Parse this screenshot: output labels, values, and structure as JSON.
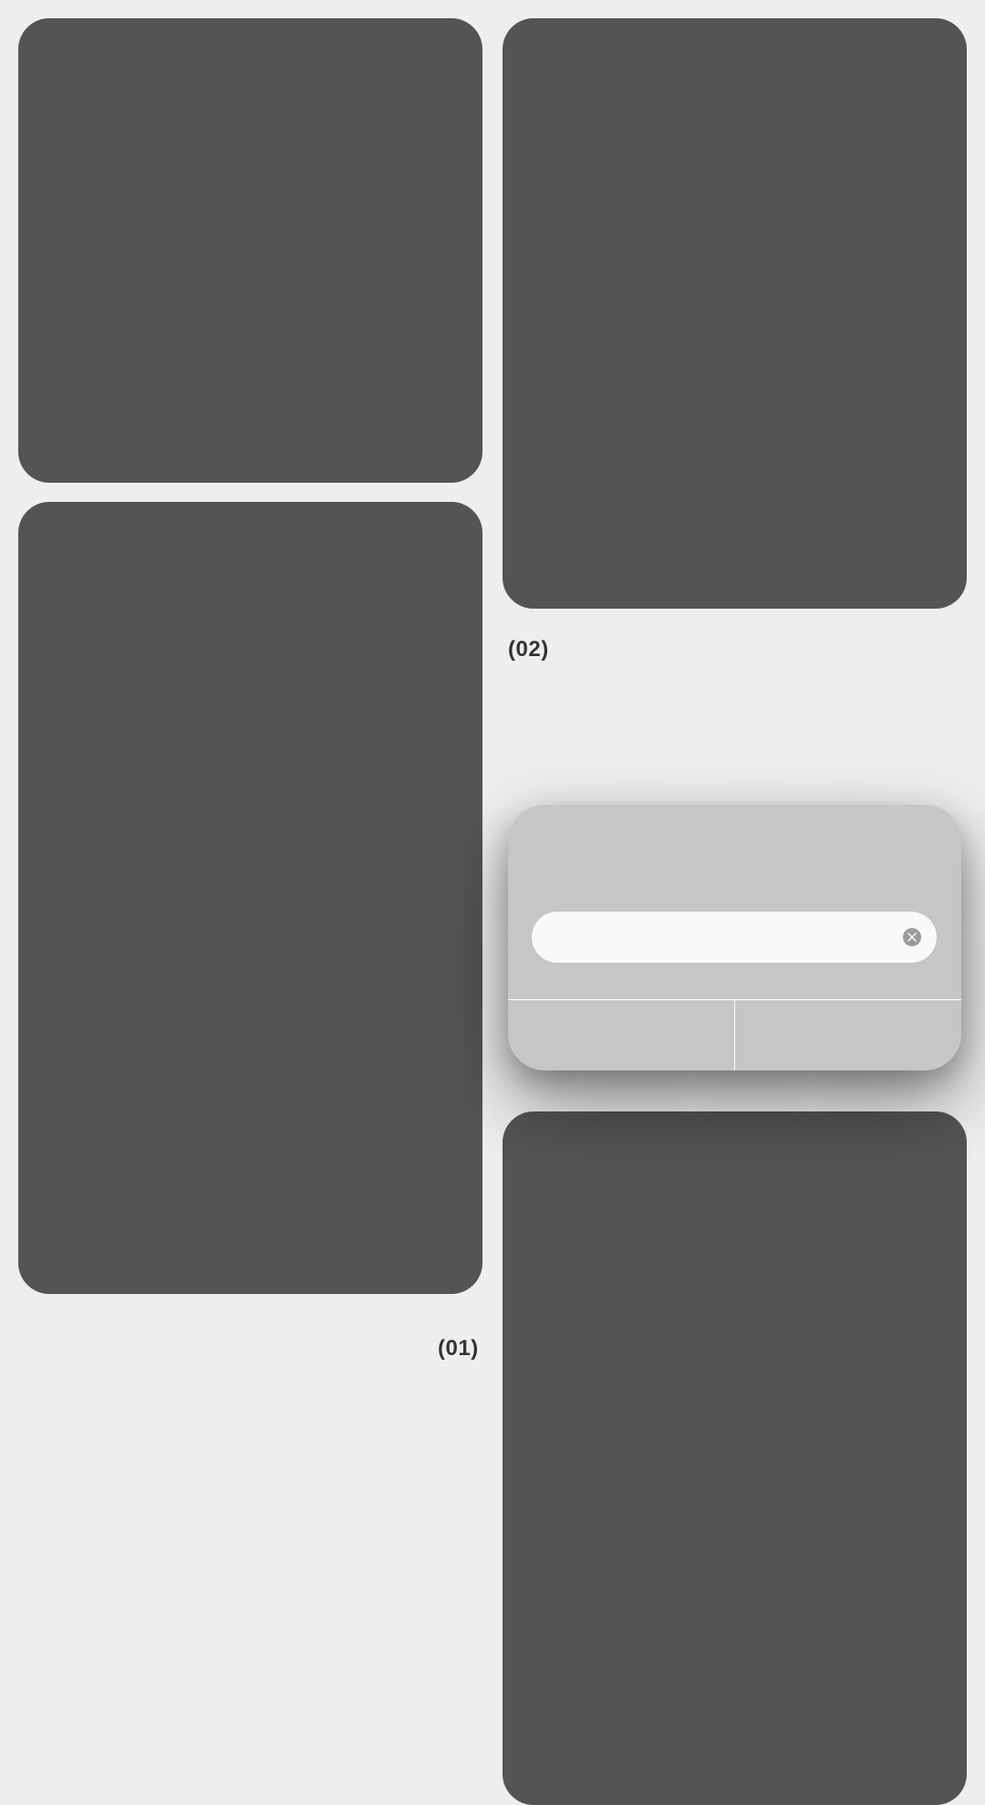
{
  "captions": {
    "first": "(01)",
    "second": "(02)"
  },
  "dialog": {
    "input_value": "",
    "input_placeholder": "",
    "clear_icon": "clear-icon",
    "left_button_label": "",
    "right_button_label": ""
  },
  "colors": {
    "background": "#efeeec",
    "card": "#545454",
    "dialog": "#c6c6c8",
    "input": "#f9f9f9",
    "caption_text": "#333333"
  }
}
